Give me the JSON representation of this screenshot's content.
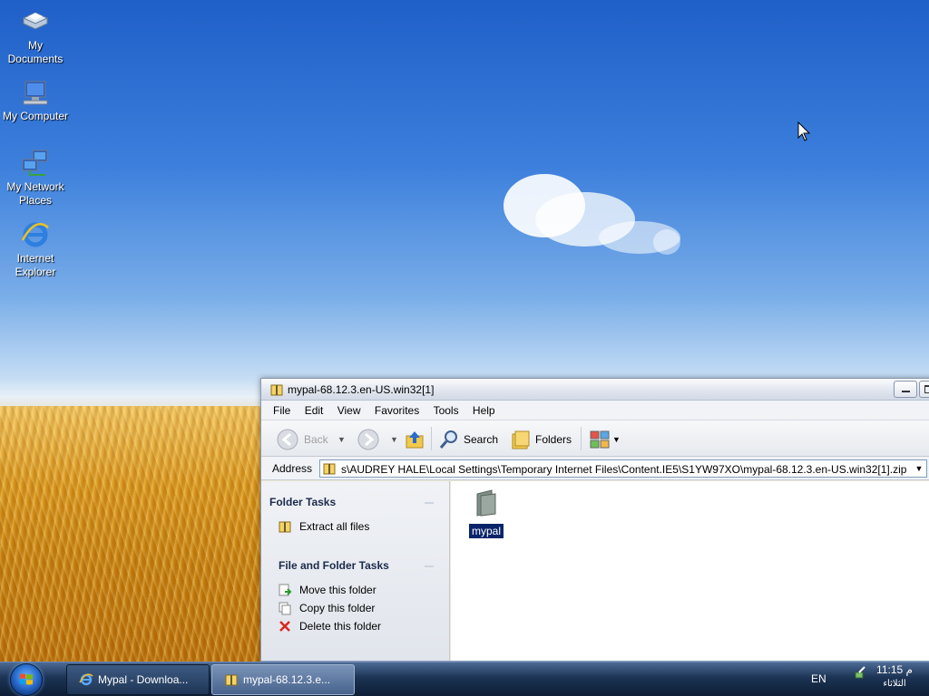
{
  "desktop": {
    "icons": [
      {
        "label": "My Documents"
      },
      {
        "label": "My Computer"
      },
      {
        "label": "My Network Places"
      },
      {
        "label": "Internet Explorer"
      }
    ]
  },
  "window": {
    "title": "mypal-68.12.3.en-US.win32[1]",
    "menu": {
      "file": "File",
      "edit": "Edit",
      "view": "View",
      "favorites": "Favorites",
      "tools": "Tools",
      "help": "Help"
    },
    "toolbar": {
      "back": "Back",
      "search": "Search",
      "folders": "Folders"
    },
    "address": {
      "label": "Address",
      "value": "s\\AUDREY HALE\\Local Settings\\Temporary Internet Files\\Content.IE5\\S1YW97XO\\mypal-68.12.3.en-US.win32[1].zip"
    },
    "tasks": {
      "folder_tasks": {
        "title": "Folder Tasks",
        "items": [
          "Extract all files"
        ]
      },
      "file_folder_tasks": {
        "title": "File and Folder Tasks",
        "items": [
          "Move this folder",
          "Copy this folder",
          "Delete this folder"
        ]
      }
    },
    "content": {
      "items": [
        {
          "label": "mypal"
        }
      ]
    }
  },
  "taskbar": {
    "buttons": [
      {
        "label": "Mypal - Downloa..."
      },
      {
        "label": "mypal-68.12.3.e..."
      }
    ],
    "language": "EN",
    "time": "11:15 م",
    "day": "الثلاثاء"
  },
  "colors": {
    "selection": "#0a246a",
    "title_text": "#000000",
    "taskbar": "#1c3354"
  }
}
